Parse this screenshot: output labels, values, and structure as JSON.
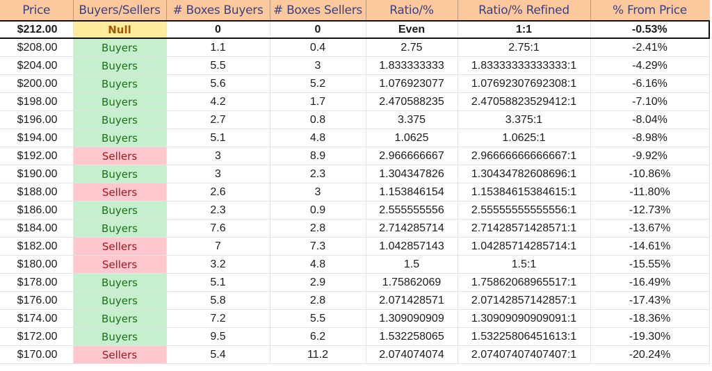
{
  "columns": [
    "Price",
    "Buyers/Sellers",
    "# Boxes Buyers",
    "# Boxes Sellers",
    "Ratio/%",
    "Ratio/% Refined",
    "% From Price"
  ],
  "highlight_row": {
    "price": "$212.00",
    "side": "Null",
    "boxes_buyers": "0",
    "boxes_sellers": "0",
    "ratio": "Even",
    "ratio_refined": "1:1",
    "pct_from_price": "-0.53%"
  },
  "rows": [
    {
      "price": "$208.00",
      "side": "Buyers",
      "boxes_buyers": "1.1",
      "boxes_sellers": "0.4",
      "ratio": "2.75",
      "ratio_refined": "2.75:1",
      "pct_from_price": "-2.41%"
    },
    {
      "price": "$204.00",
      "side": "Buyers",
      "boxes_buyers": "5.5",
      "boxes_sellers": "3",
      "ratio": "1.833333333",
      "ratio_refined": "1.83333333333333:1",
      "pct_from_price": "-4.29%"
    },
    {
      "price": "$200.00",
      "side": "Buyers",
      "boxes_buyers": "5.6",
      "boxes_sellers": "5.2",
      "ratio": "1.076923077",
      "ratio_refined": "1.07692307692308:1",
      "pct_from_price": "-6.16%"
    },
    {
      "price": "$198.00",
      "side": "Buyers",
      "boxes_buyers": "4.2",
      "boxes_sellers": "1.7",
      "ratio": "2.470588235",
      "ratio_refined": "2.47058823529412:1",
      "pct_from_price": "-7.10%"
    },
    {
      "price": "$196.00",
      "side": "Buyers",
      "boxes_buyers": "2.7",
      "boxes_sellers": "0.8",
      "ratio": "3.375",
      "ratio_refined": "3.375:1",
      "pct_from_price": "-8.04%"
    },
    {
      "price": "$194.00",
      "side": "Buyers",
      "boxes_buyers": "5.1",
      "boxes_sellers": "4.8",
      "ratio": "1.0625",
      "ratio_refined": "1.0625:1",
      "pct_from_price": "-8.98%"
    },
    {
      "price": "$192.00",
      "side": "Sellers",
      "boxes_buyers": "3",
      "boxes_sellers": "8.9",
      "ratio": "2.966666667",
      "ratio_refined": "2.96666666666667:1",
      "pct_from_price": "-9.92%"
    },
    {
      "price": "$190.00",
      "side": "Buyers",
      "boxes_buyers": "3",
      "boxes_sellers": "2.3",
      "ratio": "1.304347826",
      "ratio_refined": "1.30434782608696:1",
      "pct_from_price": "-10.86%"
    },
    {
      "price": "$188.00",
      "side": "Sellers",
      "boxes_buyers": "2.6",
      "boxes_sellers": "3",
      "ratio": "1.153846154",
      "ratio_refined": "1.15384615384615:1",
      "pct_from_price": "-11.80%"
    },
    {
      "price": "$186.00",
      "side": "Buyers",
      "boxes_buyers": "2.3",
      "boxes_sellers": "0.9",
      "ratio": "2.555555556",
      "ratio_refined": "2.55555555555556:1",
      "pct_from_price": "-12.73%"
    },
    {
      "price": "$184.00",
      "side": "Buyers",
      "boxes_buyers": "7.6",
      "boxes_sellers": "2.8",
      "ratio": "2.714285714",
      "ratio_refined": "2.71428571428571:1",
      "pct_from_price": "-13.67%"
    },
    {
      "price": "$182.00",
      "side": "Sellers",
      "boxes_buyers": "7",
      "boxes_sellers": "7.3",
      "ratio": "1.042857143",
      "ratio_refined": "1.04285714285714:1",
      "pct_from_price": "-14.61%"
    },
    {
      "price": "$180.00",
      "side": "Sellers",
      "boxes_buyers": "3.2",
      "boxes_sellers": "4.8",
      "ratio": "1.5",
      "ratio_refined": "1.5:1",
      "pct_from_price": "-15.55%"
    },
    {
      "price": "$178.00",
      "side": "Buyers",
      "boxes_buyers": "5.1",
      "boxes_sellers": "2.9",
      "ratio": "1.75862069",
      "ratio_refined": "1.75862068965517:1",
      "pct_from_price": "-16.49%"
    },
    {
      "price": "$176.00",
      "side": "Buyers",
      "boxes_buyers": "5.8",
      "boxes_sellers": "2.8",
      "ratio": "2.071428571",
      "ratio_refined": "2.07142857142857:1",
      "pct_from_price": "-17.43%"
    },
    {
      "price": "$174.00",
      "side": "Buyers",
      "boxes_buyers": "7.2",
      "boxes_sellers": "5.5",
      "ratio": "1.309090909",
      "ratio_refined": "1.30909090909091:1",
      "pct_from_price": "-18.36%"
    },
    {
      "price": "$172.00",
      "side": "Buyers",
      "boxes_buyers": "9.5",
      "boxes_sellers": "6.2",
      "ratio": "1.532258065",
      "ratio_refined": "1.53225806451613:1",
      "pct_from_price": "-19.30%"
    },
    {
      "price": "$170.00",
      "side": "Sellers",
      "boxes_buyers": "5.4",
      "boxes_sellers": "11.2",
      "ratio": "2.074074074",
      "ratio_refined": "2.07407407407407:1",
      "pct_from_price": "-20.24%"
    }
  ],
  "colors": {
    "header_bg": "#fcc99c",
    "header_text": "#3b3f83",
    "buyers_bg": "#c6efce",
    "buyers_text": "#1e6e1a",
    "sellers_bg": "#ffc7ce",
    "sellers_text": "#a0161c",
    "null_bg": "#ffeb9c",
    "null_text": "#9c5c06"
  }
}
